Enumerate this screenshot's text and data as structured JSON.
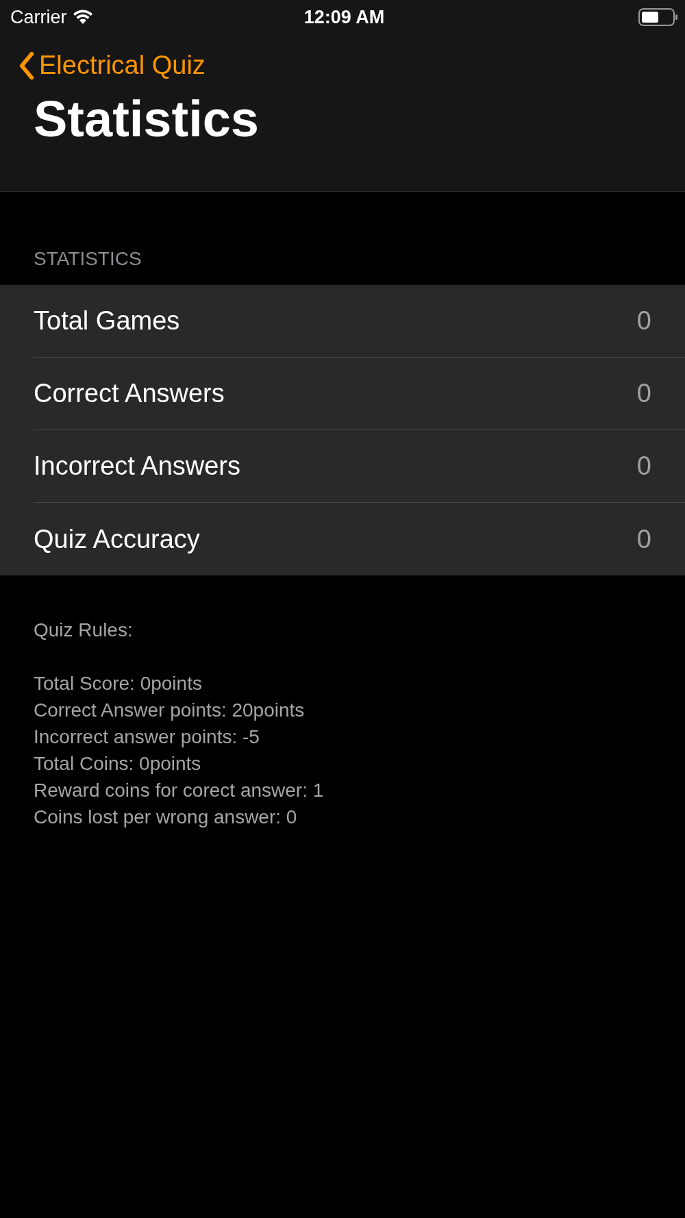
{
  "status_bar": {
    "carrier": "Carrier",
    "time": "12:09 AM"
  },
  "nav": {
    "back_label": "Electrical Quiz",
    "title": "Statistics"
  },
  "section": {
    "header": "STATISTICS",
    "rows": [
      {
        "label": "Total Games",
        "value": "0"
      },
      {
        "label": "Correct Answers",
        "value": "0"
      },
      {
        "label": "Incorrect Answers",
        "value": "0"
      },
      {
        "label": "Quiz Accuracy",
        "value": "0"
      }
    ]
  },
  "footer": {
    "heading": "Quiz Rules:",
    "lines": [
      "Total Score: 0points",
      "Correct Answer points: 20points",
      "Incorrect answer points: -5",
      "Total Coins: 0points",
      "Reward coins for corect answer: 1",
      "Coins lost per wrong answer: 0"
    ]
  }
}
